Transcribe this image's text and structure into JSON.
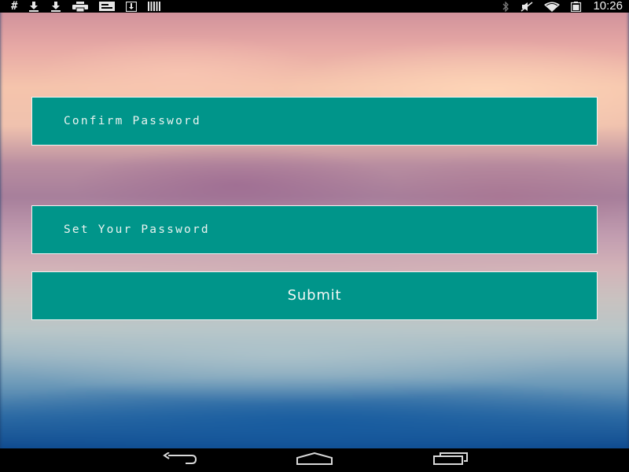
{
  "status_bar": {
    "time": "10:26",
    "left_icons": [
      "hash-icon",
      "download-icon",
      "download-icon",
      "printer-icon",
      "card-icon",
      "save-icon",
      "signal-bars-icon"
    ],
    "right_icons": [
      "bluetooth-icon",
      "mute-icon",
      "wifi-icon",
      "battery-icon"
    ],
    "hash_glyph": "#"
  },
  "form": {
    "confirm_password_placeholder": "Confirm Password",
    "set_password_placeholder": "Set Your Password",
    "submit_label": "Submit"
  },
  "colors": {
    "field_background": "#00958a",
    "field_border": "#f2f4f2",
    "bar_background": "#000000"
  },
  "nav_bar": {
    "buttons": [
      "back-icon",
      "home-icon",
      "recents-icon"
    ]
  }
}
